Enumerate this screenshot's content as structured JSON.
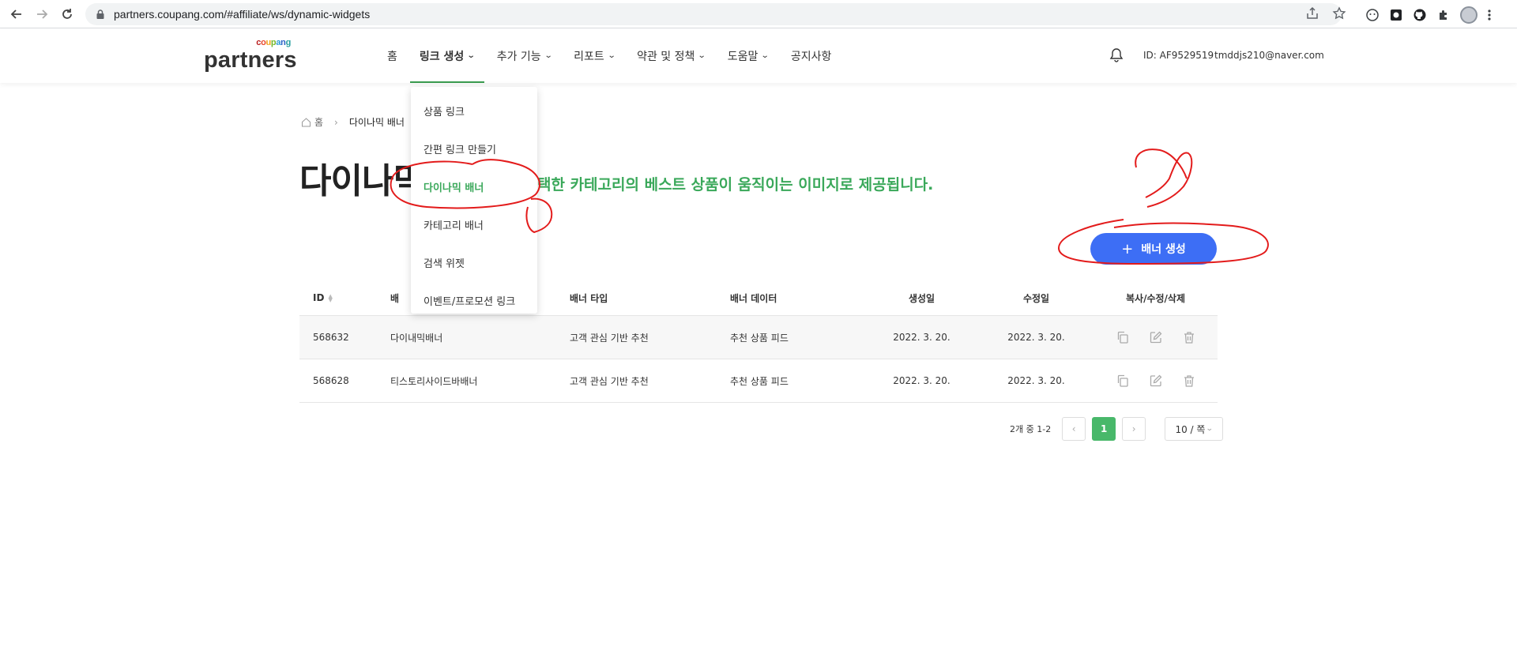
{
  "browser": {
    "url": "partners.coupang.com/#affiliate/ws/dynamic-widgets"
  },
  "header": {
    "logo_top": "coupang",
    "logo_main": "partners",
    "nav": [
      {
        "label": "홈",
        "has_menu": false
      },
      {
        "label": "링크 생성",
        "has_menu": true,
        "active": true
      },
      {
        "label": "추가 기능",
        "has_menu": true
      },
      {
        "label": "리포트",
        "has_menu": true
      },
      {
        "label": "약관 및 정책",
        "has_menu": true
      },
      {
        "label": "도움말",
        "has_menu": true
      },
      {
        "label": "공지사항",
        "has_menu": false
      }
    ],
    "user_id": "ID: AF9529519",
    "user_email": "tmddjs210@naver.com"
  },
  "dropdown": {
    "items": [
      "상품 링크",
      "간편 링크 만들기",
      "다이나믹 배너",
      "카테고리 배너",
      "검색 위젯",
      "이벤트/프로모션 링크"
    ],
    "selected_index": 2
  },
  "breadcrumb": {
    "home": "홈",
    "current": "다이나믹 배너"
  },
  "page": {
    "title": "다이나믹",
    "description": "택한 카테고리의 베스트 상품이 움직이는 이미지로 제공됩니다.",
    "create_button": "배너 생성"
  },
  "table": {
    "headers": {
      "id": "ID",
      "name": "배",
      "type": "배너 타입",
      "data": "배너 데이터",
      "created": "생성일",
      "modified": "수정일",
      "actions": "복사/수정/삭제"
    },
    "rows": [
      {
        "id": "568632",
        "name": "다이내믹배너",
        "type": "고객 관심 기반 추천",
        "data": "추천 상품 피드",
        "created": "2022. 3. 20.",
        "modified": "2022. 3. 20."
      },
      {
        "id": "568628",
        "name": "티스토리사이드바배너",
        "type": "고객 관심 기반 추천",
        "data": "추천 상품 피드",
        "created": "2022. 3. 20.",
        "modified": "2022. 3. 20."
      }
    ]
  },
  "pagination": {
    "info": "2개 중 1-2",
    "current_page": "1",
    "page_size": "10 / 쪽"
  },
  "colors": {
    "brand_green": "#3aa85a",
    "button_blue": "#3d6ef5",
    "annotation_red": "#e31b1b"
  }
}
